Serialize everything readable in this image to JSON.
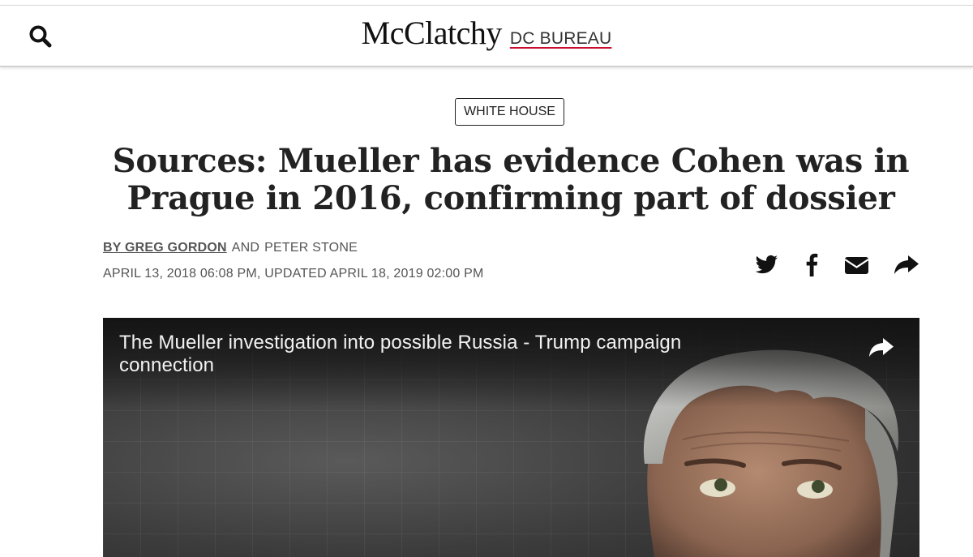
{
  "header": {
    "brand_name": "McClatchy",
    "brand_sub": "DC BUREAU",
    "search_icon": "search-icon"
  },
  "article": {
    "category": "WHITE HOUSE",
    "headline": "Sources: Mueller has evidence Cohen was in Prague in 2016, confirming part of dossier",
    "byline": {
      "author1": "BY GREG GORDON",
      "and": "AND",
      "author2": "PETER STONE"
    },
    "dateline": "APRIL 13, 2018 06:08 PM, UPDATED APRIL 18, 2019 02:00 PM",
    "share_icons": [
      "twitter-icon",
      "facebook-icon",
      "email-icon",
      "share-icon"
    ]
  },
  "video": {
    "title": "The Mueller investigation into possible Russia - Trump campaign connection",
    "share_icon": "share-icon"
  },
  "colors": {
    "brand_underline": "#c8102e",
    "text": "#222222",
    "meta": "#555555"
  }
}
